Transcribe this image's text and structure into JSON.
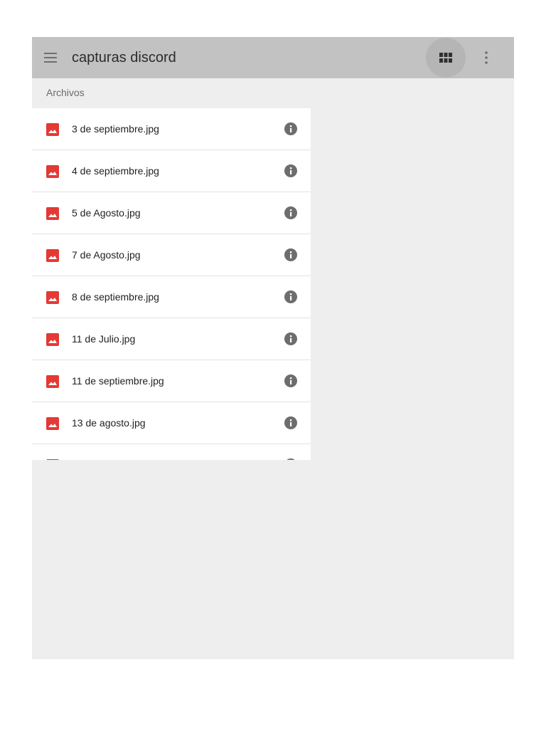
{
  "toolbar": {
    "title": "capturas discord",
    "menu_icon": "hamburger-menu-icon",
    "view_toggle_icon": "grid-view-icon",
    "more_icon": "more-vert-icon",
    "background": "#c2c2c2"
  },
  "section": {
    "label": "Archivos"
  },
  "files": [
    {
      "name": "3 de septiembre.jpg",
      "icon": "image-file-icon"
    },
    {
      "name": "4 de septiembre.jpg",
      "icon": "image-file-icon"
    },
    {
      "name": "5 de Agosto.jpg",
      "icon": "image-file-icon"
    },
    {
      "name": "7 de Agosto.jpg",
      "icon": "image-file-icon"
    },
    {
      "name": "8 de septiembre.jpg",
      "icon": "image-file-icon"
    },
    {
      "name": "11 de Julio.jpg",
      "icon": "image-file-icon"
    },
    {
      "name": "11 de septiembre.jpg",
      "icon": "image-file-icon"
    },
    {
      "name": "13 de agosto.jpg",
      "icon": "image-file-icon"
    },
    {
      "name": "",
      "icon": "image-file-icon"
    }
  ],
  "colors": {
    "image_icon": "#e53935",
    "info_icon": "#6d6d6d",
    "panel_background": "#eeeeee"
  }
}
